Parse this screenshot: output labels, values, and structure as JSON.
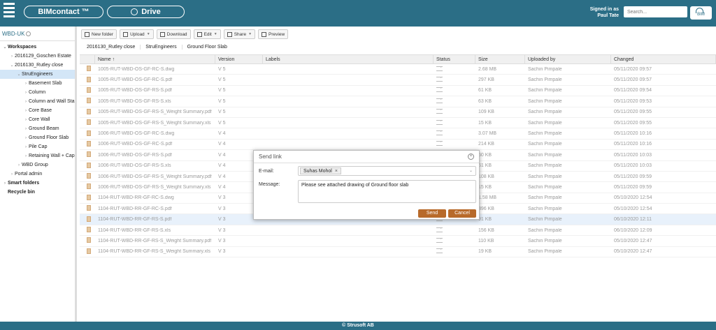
{
  "header": {
    "brand_label": "BIMcontact ™",
    "drive_label": "Drive",
    "signed_in_label": "Signed in as",
    "user_name": "Paul Tate",
    "search_placeholder": "Search...",
    "user_badge": "BIM"
  },
  "sidebar": {
    "workspace_title": "WBD-UK",
    "tree": [
      {
        "label": "Workspaces",
        "bold": true,
        "caret": "⌄",
        "indent": 0
      },
      {
        "label": "2016129_Goschen Estate",
        "caret": "›",
        "indent": 1
      },
      {
        "label": "2016130_Rutley close",
        "caret": "⌄",
        "indent": 1
      },
      {
        "label": "StruEngineers",
        "caret": "⌄",
        "indent": 2,
        "selected": true
      },
      {
        "label": "Basement Slab",
        "caret": "›",
        "indent": 3
      },
      {
        "label": "Column",
        "caret": "›",
        "indent": 3
      },
      {
        "label": "Column and Wall Starters",
        "caret": "›",
        "indent": 3
      },
      {
        "label": "Core Base",
        "caret": "›",
        "indent": 3
      },
      {
        "label": "Core Wall",
        "caret": "›",
        "indent": 3
      },
      {
        "label": "Ground Beam",
        "caret": "›",
        "indent": 3
      },
      {
        "label": "Ground Floor Slab",
        "caret": "›",
        "indent": 3
      },
      {
        "label": "Pile Cap",
        "caret": "›",
        "indent": 3
      },
      {
        "label": "Retaining Wall + Cap",
        "caret": "›",
        "indent": 3
      },
      {
        "label": "WBD Group",
        "caret": "›",
        "indent": 2
      },
      {
        "label": "Portal admin",
        "caret": "›",
        "indent": 1
      },
      {
        "label": "Smart folders",
        "bold": true,
        "caret": "›",
        "indent": 0
      },
      {
        "label": "Recycle bin",
        "bold": true,
        "caret": "",
        "indent": 0
      }
    ]
  },
  "toolbar": {
    "new_folder": "New folder",
    "upload": "Upload",
    "download": "Download",
    "edit": "Edit",
    "share": "Share",
    "preview": "Preview"
  },
  "breadcrumb": [
    "2016130_Rutley close",
    "StruEngineers",
    "Ground Floor Slab"
  ],
  "table": {
    "headers": {
      "name": "Name ↑",
      "version": "Version",
      "labels": "Labels",
      "status": "Status",
      "size": "Size",
      "uploaded_by": "Uploaded by",
      "changed": "Changed"
    },
    "rows": [
      {
        "name": "1005-RUT-WBD-OS-GF-RC-S.dwg",
        "version": "V 5",
        "size": "2.68 MB",
        "uploaded_by": "Sachin Pimpale",
        "changed": "05/11/2020 09:57"
      },
      {
        "name": "1005-RUT-WBD-OS-GF-RC-S.pdf",
        "version": "V 5",
        "size": "297 KB",
        "uploaded_by": "Sachin Pimpale",
        "changed": "05/11/2020 09:57"
      },
      {
        "name": "1005-RUT-WBD-OS-GF-RS-S.pdf",
        "version": "V 5",
        "size": "61 KB",
        "uploaded_by": "Sachin Pimpale",
        "changed": "05/11/2020 09:54"
      },
      {
        "name": "1005-RUT-WBD-OS-GF-RS-S.xls",
        "version": "V 5",
        "size": "63 KB",
        "uploaded_by": "Sachin Pimpale",
        "changed": "05/11/2020 09:53"
      },
      {
        "name": "1005-RUT-WBD-OS-GF-RS-S_Weight Summary.pdf",
        "version": "V 5",
        "size": "109 KB",
        "uploaded_by": "Sachin Pimpale",
        "changed": "05/11/2020 09:55"
      },
      {
        "name": "1005-RUT-WBD-OS-GF-RS-S_Weight Summary.xls",
        "version": "V 5",
        "size": "15 KB",
        "uploaded_by": "Sachin Pimpale",
        "changed": "05/11/2020 09:55"
      },
      {
        "name": "1006-RUT-WBD-OS-GF-RC-S.dwg",
        "version": "V 4",
        "size": "3.07 MB",
        "uploaded_by": "Sachin Pimpale",
        "changed": "05/11/2020 10:16"
      },
      {
        "name": "1006-RUT-WBD-OS-GF-RC-S.pdf",
        "version": "V 4",
        "size": "214 KB",
        "uploaded_by": "Sachin Pimpale",
        "changed": "05/11/2020 10:16"
      },
      {
        "name": "1006-RUT-WBD-OS-GF-RS-S.pdf",
        "version": "V 4",
        "size": "60 KB",
        "uploaded_by": "Sachin Pimpale",
        "changed": "05/11/2020 10:03"
      },
      {
        "name": "1006-RUT-WBD-OS-GF-RS-S.xls",
        "version": "V 4",
        "size": "61 KB",
        "uploaded_by": "Sachin Pimpale",
        "changed": "05/11/2020 10:03"
      },
      {
        "name": "1006-RUT-WBD-OS-GF-RS-S_Weight Summary.pdf",
        "version": "V 4",
        "size": "108 KB",
        "uploaded_by": "Sachin Pimpale",
        "changed": "05/11/2020 09:59"
      },
      {
        "name": "1006-RUT-WBD-OS-GF-RS-S_Weight Summary.xls",
        "version": "V 4",
        "size": "15 KB",
        "uploaded_by": "Sachin Pimpale",
        "changed": "05/11/2020 09:59"
      },
      {
        "name": "1104-RUT-WBD-RR-GF-RC-S.dwg",
        "version": "V 3",
        "size": "1.58 MB",
        "uploaded_by": "Sachin Pimpale",
        "changed": "05/10/2020 12:54"
      },
      {
        "name": "1104-RUT-WBD-RR-GF-RC-S.pdf",
        "version": "V 3",
        "size": "396 KB",
        "uploaded_by": "Sachin Pimpale",
        "changed": "05/10/2020 12:54"
      },
      {
        "name": "1104-RUT-WBD-RR-GF-RS-S.pdf",
        "version": "V 3",
        "size": "91 KB",
        "uploaded_by": "Sachin Pimpale",
        "changed": "06/10/2020 12:11",
        "highlight": true
      },
      {
        "name": "1104-RUT-WBD-RR-GF-RS-S.xls",
        "version": "V 3",
        "size": "156 KB",
        "uploaded_by": "Sachin Pimpale",
        "changed": "06/10/2020 12:09"
      },
      {
        "name": "1104-RUT-WBD-RR-GF-RS-S_Weight Summary.pdf",
        "version": "V 3",
        "size": "110 KB",
        "uploaded_by": "Sachin Pimpale",
        "changed": "05/10/2020 12:47"
      },
      {
        "name": "1104-RUT-WBD-RR-GF-RS-S_Weight Summary.xls",
        "version": "V 3",
        "size": "19 KB",
        "uploaded_by": "Sachin Pimpale",
        "changed": "05/10/2020 12:47"
      }
    ]
  },
  "dialog": {
    "title": "Send link",
    "email_label": "E-mail:",
    "recipient": "Suhas Mohol",
    "message_label": "Message:",
    "message": "Please see attached drawing of Ground floor slab",
    "send": "Send",
    "cancel": "Cancel"
  },
  "footer": {
    "text": "© Strusoft AB"
  }
}
